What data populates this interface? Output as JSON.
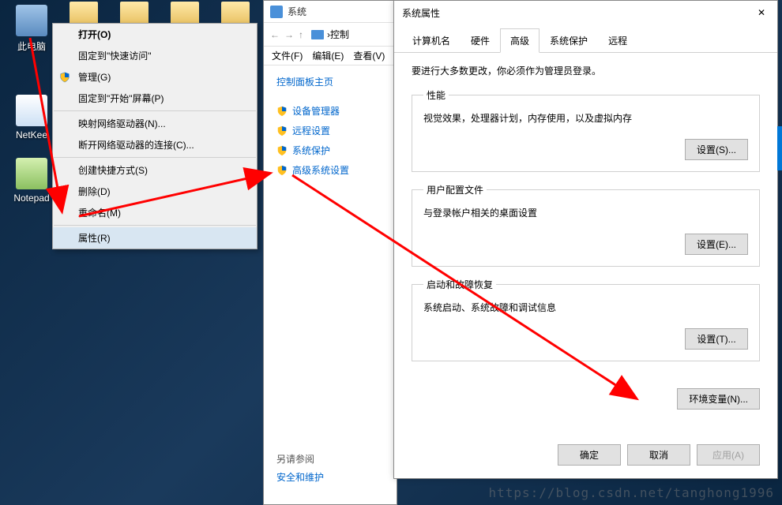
{
  "desktop": {
    "icons": [
      {
        "id": "this-pc",
        "label": "此电脑"
      },
      {
        "id": "netkee",
        "label": "NetKee"
      },
      {
        "id": "notepad",
        "label": "Notepad"
      }
    ]
  },
  "context_menu": {
    "items": [
      {
        "label": "打开(O)",
        "bold": true
      },
      {
        "label": "固定到\"快速访问\""
      },
      {
        "label": "管理(G)",
        "shield": true
      },
      {
        "label": "固定到\"开始\"屏幕(P)"
      },
      {
        "sep": true
      },
      {
        "label": "映射网络驱动器(N)..."
      },
      {
        "label": "断开网络驱动器的连接(C)..."
      },
      {
        "sep": true
      },
      {
        "label": "创建快捷方式(S)"
      },
      {
        "label": "删除(D)"
      },
      {
        "label": "重命名(M)"
      },
      {
        "sep": true
      },
      {
        "label": "属性(R)",
        "highlighted": true
      }
    ]
  },
  "system_window": {
    "title": "系统",
    "breadcrumb": "控制",
    "breadcrumb_sep": "›",
    "menubar": [
      "文件(F)",
      "编辑(E)",
      "查看(V)"
    ],
    "sidebar_home": "控制面板主页",
    "sidebar_links": [
      "设备管理器",
      "远程设置",
      "系统保护",
      "高级系统设置"
    ],
    "footer_heading": "另请参阅",
    "footer_link": "安全和维护"
  },
  "props_dialog": {
    "title": "系统属性",
    "tabs": [
      "计算机名",
      "硬件",
      "高级",
      "系统保护",
      "远程"
    ],
    "active_tab": 2,
    "intro": "要进行大多数更改，你必须作为管理员登录。",
    "groups": [
      {
        "legend": "性能",
        "text": "视觉效果，处理器计划，内存使用，以及虚拟内存",
        "button": "设置(S)..."
      },
      {
        "legend": "用户配置文件",
        "text": "与登录帐户相关的桌面设置",
        "button": "设置(E)..."
      },
      {
        "legend": "启动和故障恢复",
        "text": "系统启动、系统故障和调试信息",
        "button": "设置(T)..."
      }
    ],
    "env_button": "环境变量(N)...",
    "buttons": {
      "ok": "确定",
      "cancel": "取消",
      "apply": "应用(A)"
    }
  },
  "watermark": "https://blog.csdn.net/tanghong1996"
}
